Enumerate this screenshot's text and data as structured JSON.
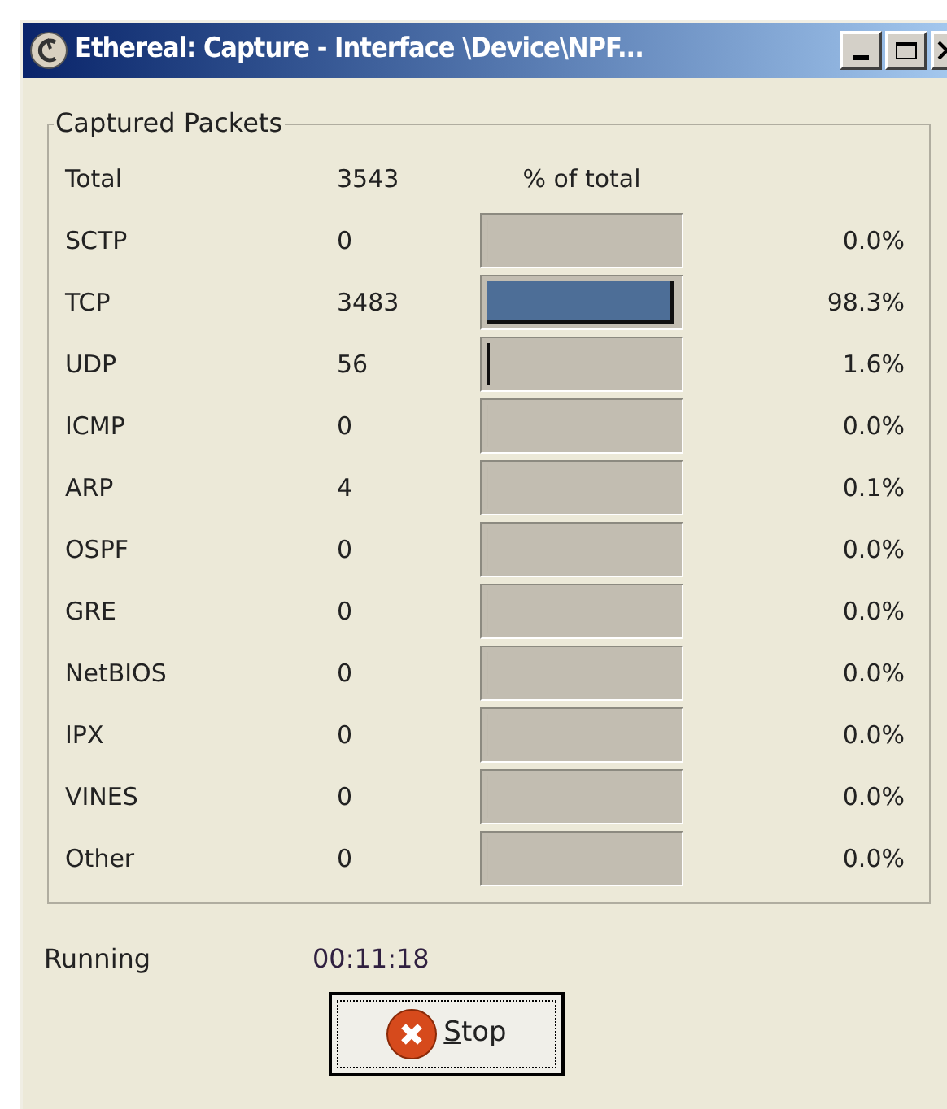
{
  "window": {
    "title": "Ethereal: Capture - Interface \\Device\\NPF..."
  },
  "group": {
    "title": "Captured Packets"
  },
  "total": {
    "label": "Total",
    "count": "3543",
    "bar_header": "% of total"
  },
  "rows": [
    {
      "label": "SCTP",
      "count": "0",
      "level": 0.0,
      "percent": "0.0%"
    },
    {
      "label": "TCP",
      "count": "3483",
      "level": 0.983,
      "percent": "98.3%"
    },
    {
      "label": "UDP",
      "count": "56",
      "level": 0.016,
      "percent": "1.6%"
    },
    {
      "label": "ICMP",
      "count": "0",
      "level": 0.0,
      "percent": "0.0%"
    },
    {
      "label": "ARP",
      "count": "4",
      "level": 0.001,
      "percent": "0.1%"
    },
    {
      "label": "OSPF",
      "count": "0",
      "level": 0.0,
      "percent": "0.0%"
    },
    {
      "label": "GRE",
      "count": "0",
      "level": 0.0,
      "percent": "0.0%"
    },
    {
      "label": "NetBIOS",
      "count": "0",
      "level": 0.0,
      "percent": "0.0%"
    },
    {
      "label": "IPX",
      "count": "0",
      "level": 0.0,
      "percent": "0.0%"
    },
    {
      "label": "VINES",
      "count": "0",
      "level": 0.0,
      "percent": "0.0%"
    },
    {
      "label": "Other",
      "count": "0",
      "level": 0.0,
      "percent": "0.0%"
    }
  ],
  "status": {
    "label": "Running",
    "elapsed": "00:11:18"
  },
  "buttons": [
    {
      "label": "Stop"
    }
  ]
}
